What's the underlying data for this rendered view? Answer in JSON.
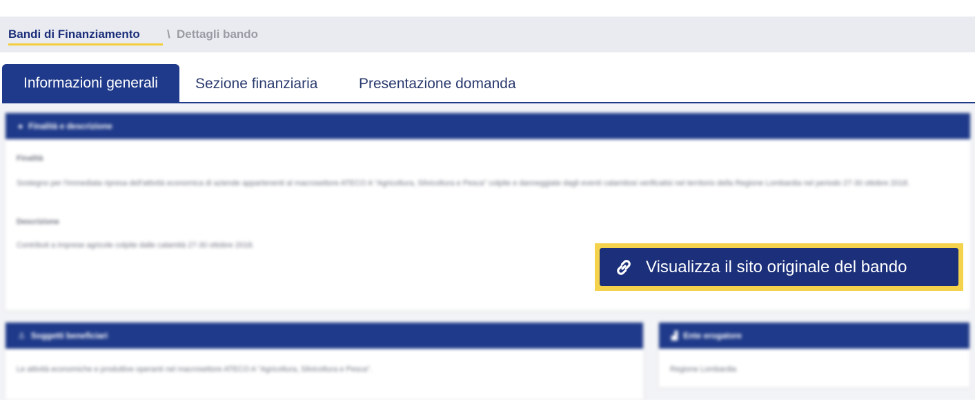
{
  "breadcrumb": {
    "root": "Bandi di Finanziamento",
    "separator": "\\",
    "current": "Dettagli bando"
  },
  "tabs": [
    {
      "label": "Informazioni generali",
      "active": true
    },
    {
      "label": "Sezione finanziaria",
      "active": false
    },
    {
      "label": "Presentazione domanda",
      "active": false
    }
  ],
  "panels": {
    "main": {
      "title": "Finalità e descrizione",
      "icon": "info-icon",
      "finalita_label": "Finalità",
      "finalita_text": "Sostegno per l'immediata ripresa dell'attività economica di aziende appartenenti al macrosettore ATECO A \"Agricoltura, Silvicoltura e Pesca\" colpite e danneggiate dagli eventi calamitosi verificatisi nel territorio della Regione Lombardia nel periodo 27-30 ottobre 2018.",
      "descrizione_label": "Descrizione",
      "descrizione_text": "Contributi a imprese agricole colpite dalle calamità 27-30 ottobre 2018."
    },
    "soggetti": {
      "title": "Soggetti beneficiari",
      "icon": "user-icon",
      "text": "Le attività economiche e produttive operanti nel macrosettore ATECO A \"Agricoltura, Silvicoltura e Pesca\"."
    },
    "ente": {
      "title": "Ente erogatore",
      "icon": "building-icon",
      "text": "Regione Lombardia"
    }
  },
  "cta": {
    "label": "Visualizza il sito originale del bando",
    "icon": "link-icon",
    "highlight_color": "#f5d24b"
  },
  "colors": {
    "brand_blue": "#1f3a8a",
    "accent_yellow": "#f3cd3a"
  }
}
